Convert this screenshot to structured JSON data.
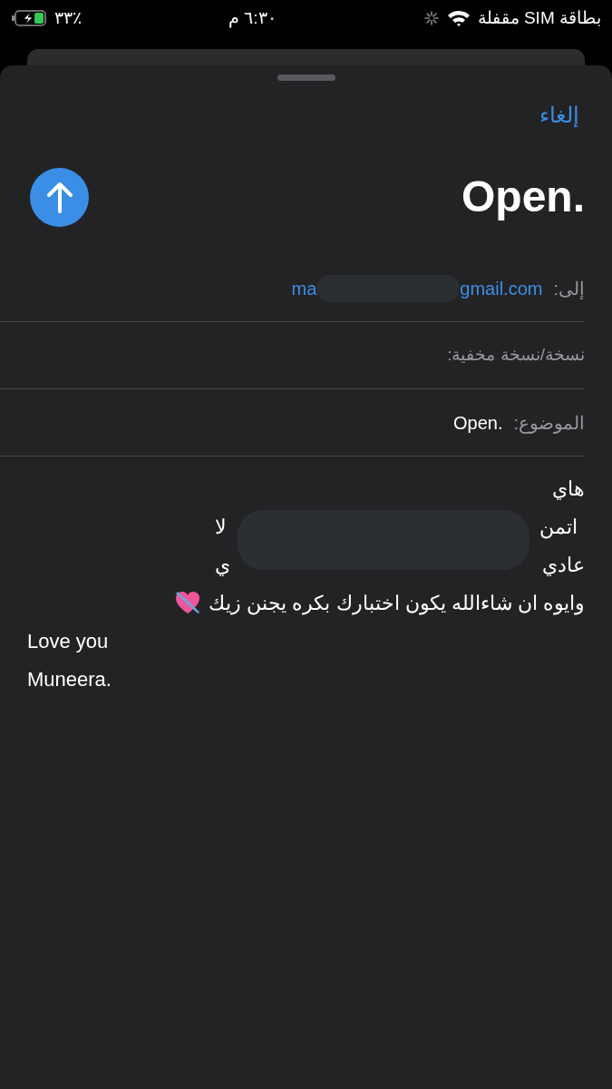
{
  "status_bar": {
    "carrier": "بطاقة SIM مقفلة",
    "time": "٦:٣٠ م",
    "battery": "٪٣٣",
    "charging": true
  },
  "sheet": {
    "cancel": "إلغاء",
    "title": "Open.",
    "to": {
      "label": "إلى:",
      "value_start": "ma",
      "value_end": "gmail.com"
    },
    "cc": {
      "label": "نسخة/نسخة مخفية:"
    },
    "subject": {
      "label": "الموضوع:",
      "value": "Open."
    },
    "body": {
      "rtl_lines": [
        {
          "right": "هاي"
        },
        {
          "right": "اتمن",
          "left": "لا"
        },
        {
          "right": "عادي",
          "left": "ي"
        },
        {
          "right": "وايوه ان شاءالله يكون اختبارك بكره يجنن زيك",
          "emoji": true
        }
      ],
      "ltr_lines": [
        "Love you",
        "Muneera."
      ]
    }
  }
}
